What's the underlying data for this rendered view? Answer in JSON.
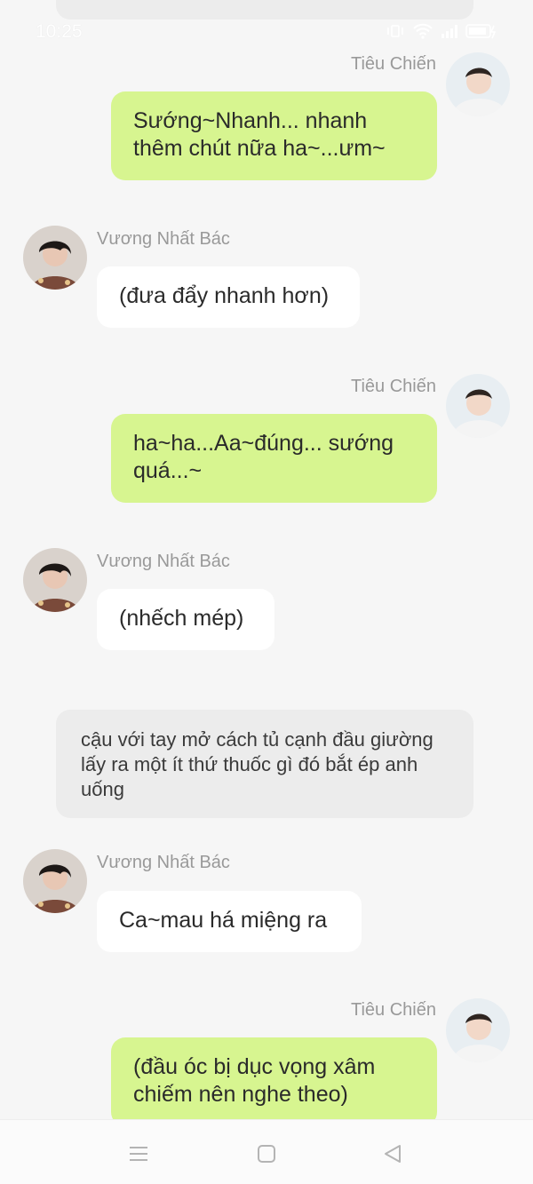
{
  "status_bar": {
    "time": "10:25"
  },
  "messages": [
    {
      "sender": "Tiêu Chiến",
      "text": "Sướng~Nhanh... nhanh thêm chút nữa ha~...ưm~"
    },
    {
      "sender": "Vương Nhất Bác",
      "text": "(đưa đẩy nhanh hơn)"
    },
    {
      "sender": "Tiêu Chiến",
      "text": "ha~ha...Aa~đúng... sướng quá...~"
    },
    {
      "sender": "Vương Nhất Bác",
      "text": "(nhếch mép)"
    },
    {
      "narration": "cậu với tay mở cách tủ cạnh đầu giường lấy ra một ít thứ thuốc gì đó bắt ép anh uống"
    },
    {
      "sender": "Vương Nhất Bác",
      "text": "Ca~mau há miệng ra"
    },
    {
      "sender": "Tiêu Chiến",
      "text": "(đầu óc bị dục vọng xâm chiếm nên nghe theo)"
    }
  ],
  "nav": {
    "menu_icon": "menu-icon",
    "home_icon": "home-icon",
    "back_icon": "back-icon"
  },
  "colors": {
    "background": "#f6f6f6",
    "bubble_right": "#d7f590",
    "bubble_left": "#ffffff",
    "narration": "#ececec",
    "name": "#999999"
  }
}
